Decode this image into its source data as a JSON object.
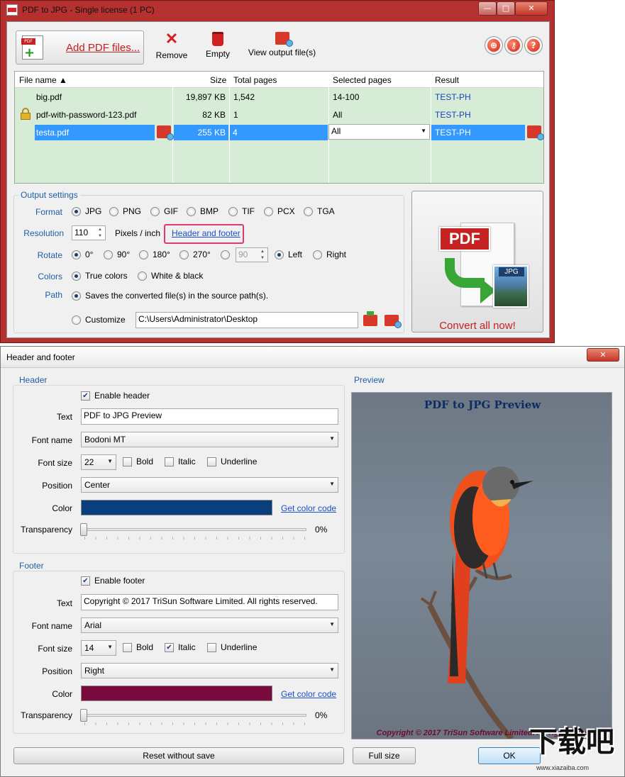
{
  "main_window": {
    "title": "PDF to JPG - Single license (1 PC)",
    "caption_buttons": [
      "—",
      "□",
      "✕"
    ]
  },
  "toolbar": {
    "add_label": "Add PDF files...",
    "remove_label": "Remove",
    "empty_label": "Empty",
    "view_output_label": "View output file(s)"
  },
  "file_list": {
    "columns": [
      "File name ▲",
      "Size",
      "Total pages",
      "Selected pages",
      "Result"
    ],
    "rows": [
      {
        "name": "big.pdf",
        "size": "19,897 KB",
        "pages": "1,542",
        "selected": "14-100",
        "result": "TEST-PH"
      },
      {
        "name": "pdf-with-password-123.pdf",
        "size": "82 KB",
        "pages": "1",
        "selected": "All",
        "result": "TEST-PH"
      },
      {
        "name": "testa.pdf",
        "size": "255 KB",
        "pages": "4",
        "selected": "All",
        "result": "TEST-PH"
      }
    ]
  },
  "output_settings": {
    "title": "Output settings",
    "format_label": "Format",
    "formats": [
      "JPG",
      "PNG",
      "GIF",
      "BMP",
      "TIF",
      "PCX",
      "TGA"
    ],
    "resolution_label": "Resolution",
    "resolution_value": "110",
    "pixels_per_inch": "Pixels / inch",
    "header_footer_link": "Header and footer",
    "rotate_label": "Rotate",
    "rotate_options": [
      "0°",
      "90°",
      "180°",
      "270°"
    ],
    "rotate_custom_value": "90",
    "left_label": "Left",
    "right_label": "Right",
    "colors_label": "Colors",
    "true_colors": "True colors",
    "white_black": "White & black",
    "path_label": "Path",
    "source_path_text": "Saves the converted file(s) in the source path(s).",
    "customize_label": "Customize",
    "customize_path": "C:\\Users\\Administrator\\Desktop"
  },
  "convert": {
    "badge_pdf": "PDF",
    "badge_jpg": "JPG",
    "label": "Convert all now!"
  },
  "hf_dialog": {
    "title": "Header and footer",
    "close": "✕",
    "header": {
      "title": "Header",
      "enable_label": "Enable header",
      "text_label": "Text",
      "text_value": "PDF to JPG Preview",
      "font_name_label": "Font name",
      "font_name_value": "Bodoni MT",
      "font_size_label": "Font size",
      "font_size_value": "22",
      "bold": "Bold",
      "italic": "Italic",
      "underline": "Underline",
      "position_label": "Position",
      "position_value": "Center",
      "color_label": "Color",
      "color_value": "#0b3e7c",
      "get_color_code": "Get color code",
      "transparency_label": "Transparency",
      "transparency_value": "0%"
    },
    "footer": {
      "title": "Footer",
      "enable_label": "Enable footer",
      "text_label": "Text",
      "text_value": "Copyright © 2017 TriSun Software Limited. All rights reserved.",
      "font_name_label": "Font name",
      "font_name_value": "Arial",
      "font_size_label": "Font size",
      "font_size_value": "14",
      "bold": "Bold",
      "italic": "Italic",
      "underline": "Underline",
      "position_label": "Position",
      "position_value": "Right",
      "color_label": "Color",
      "color_value": "#7a0b3e",
      "get_color_code": "Get color code",
      "transparency_label": "Transparency",
      "transparency_value": "0%"
    },
    "preview": {
      "title": "Preview",
      "header_text": "PDF to JPG Preview",
      "footer_text": "Copyright © 2017 TriSun Software Limited. All rights reserved."
    },
    "buttons": {
      "reset": "Reset without save",
      "full_size": "Full size",
      "ok": "OK"
    }
  },
  "watermark": {
    "text": "下载吧",
    "url": "www.xiazaiba.com"
  }
}
